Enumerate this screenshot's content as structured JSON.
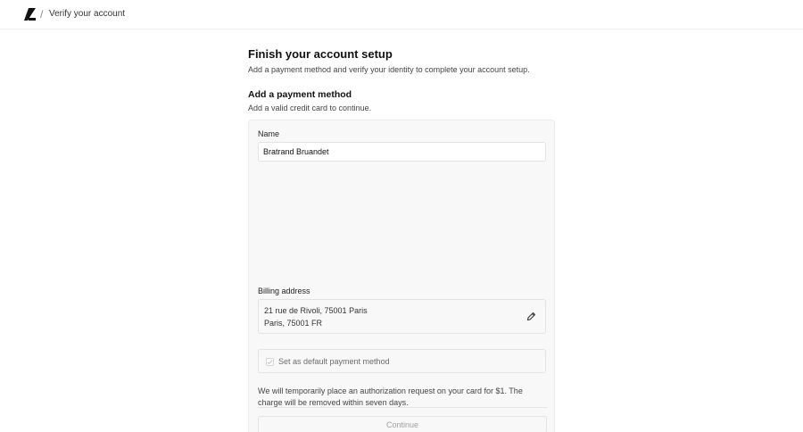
{
  "header": {
    "breadcrumb_separator": "/",
    "page_label": "Verify your account"
  },
  "main": {
    "title": "Finish your account setup",
    "subtitle": "Add a payment method and verify your identity to complete your account setup.",
    "section_title": "Add a payment method",
    "section_subtitle": "Add a valid credit card to continue."
  },
  "form": {
    "name_label": "Name",
    "name_value": "Bratrand Bruandet",
    "billing_label": "Billing address",
    "address_line1": "21 rue de Rivoli, 75001 Paris",
    "address_line2": "Paris, 75001 FR",
    "default_label": "Set as default payment method",
    "note": "We will temporarily place an authorization request on your card for $1. The charge will be removed within seven days.",
    "continue_label": "Continue"
  }
}
